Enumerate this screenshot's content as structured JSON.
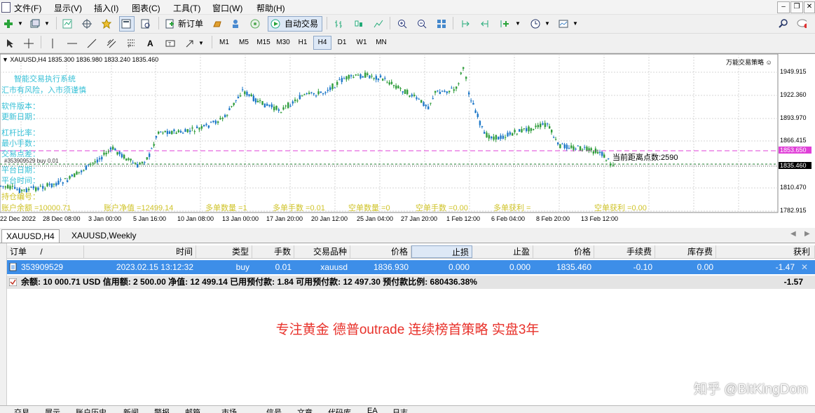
{
  "menu": {
    "items": [
      "文件(F)",
      "显示(V)",
      "插入(I)",
      "图表(C)",
      "工具(T)",
      "窗口(W)",
      "帮助(H)"
    ]
  },
  "toolbar": {
    "new_order_label": "新订单",
    "auto_trade_label": "自动交易",
    "timeframes": [
      "M1",
      "M5",
      "M15",
      "M30",
      "H1",
      "H4",
      "D1",
      "W1",
      "MN"
    ],
    "active_timeframe": "H4"
  },
  "chart": {
    "header": "XAUUSD,H4  1835.300 1836.980 1833.240 1835.460",
    "ea_label": "万能交易策略",
    "overlay_lines": [
      {
        "text": "智能交易执行系统",
        "color": "cyan"
      },
      {
        "text": "汇市有风险，入市须谨慎",
        "color": "cyan"
      },
      {
        "text": "软件版本：",
        "color": "cyan"
      },
      {
        "text": "更新日期：",
        "color": "cyan"
      },
      {
        "text": "杠杆比率：",
        "color": "cyan"
      },
      {
        "text": "最小手数：",
        "color": "cyan"
      },
      {
        "text": "交易点差：",
        "color": "cyan"
      },
      {
        "text": "平台日期：",
        "color": "cyan"
      },
      {
        "text": "平台时间：",
        "color": "cyan"
      },
      {
        "text": "持仓编号：",
        "color": "yellow"
      }
    ],
    "order_line_label": "#353909529 buy 0.01",
    "distance_label": "当前距离点数:2590",
    "bottom_stats": [
      "账户余额 =10000.71",
      "账户净值 =12499.14",
      "多单数量 =1",
      "多单手数 =0.01",
      "空单数量 =0",
      "空单手数 =0.00",
      "多单获利 =",
      "空单获利 =0.00"
    ],
    "price_axis": [
      "1949.915",
      "1922.360",
      "1893.970",
      "1866.415",
      "1853.650",
      "1835.460",
      "1810.470",
      "1782.915"
    ],
    "magenta_price": "1853.650",
    "current_price": "1835.460",
    "time_axis": [
      "22 Dec 2022",
      "28 Dec 08:00",
      "3 Jan 00:00",
      "5 Jan 16:00",
      "10 Jan 08:00",
      "13 Jan 00:00",
      "17 Jan 20:00",
      "20 Jan 12:00",
      "25 Jan 04:00",
      "27 Jan 20:00",
      "1 Feb 12:00",
      "6 Feb 04:00",
      "8 Feb 20:00",
      "13 Feb 12:00"
    ],
    "colors": {
      "bull": "#2e9c3a",
      "bear": "#1e78c8",
      "magenta": "#e040d8",
      "grid": "#d4d4d4"
    }
  },
  "chart_tabs": [
    "XAUUSD,H4",
    "XAUUSD,Weekly"
  ],
  "terminal": {
    "columns": [
      "订单",
      "时间",
      "类型",
      "手数",
      "交易品种",
      "价格",
      "止损",
      "止盈",
      "价格",
      "手续费",
      "库存费",
      "获利"
    ],
    "sort_marker": "/",
    "order": {
      "ticket": "353909529",
      "time": "2023.02.15 13:12:32",
      "type": "buy",
      "lots": "0.01",
      "symbol": "xauusd",
      "open_price": "1836.930",
      "sl": "0.000",
      "tp": "0.000",
      "price": "1835.460",
      "commission": "-0.10",
      "swap": "0.00",
      "profit": "-1.47"
    },
    "balance_text": "余额: 10 000.71 USD  信用额: 2 500.00  净值: 12 499.14  已用预付款: 1.84  可用预付款: 12 497.30  预付款比例: 680436.38%",
    "total_profit": "-1.57",
    "slogan": "专注黄金  德普outrade 连续榜首策略  实盘3年",
    "watermark": "知乎 @BitKingDom"
  },
  "bottom_tabs": [
    "交易",
    "展示",
    "账户历史",
    "新闻",
    "警报",
    "邮箱",
    "市场",
    "信号",
    "文章",
    "代码库",
    "EA",
    "日志"
  ]
}
